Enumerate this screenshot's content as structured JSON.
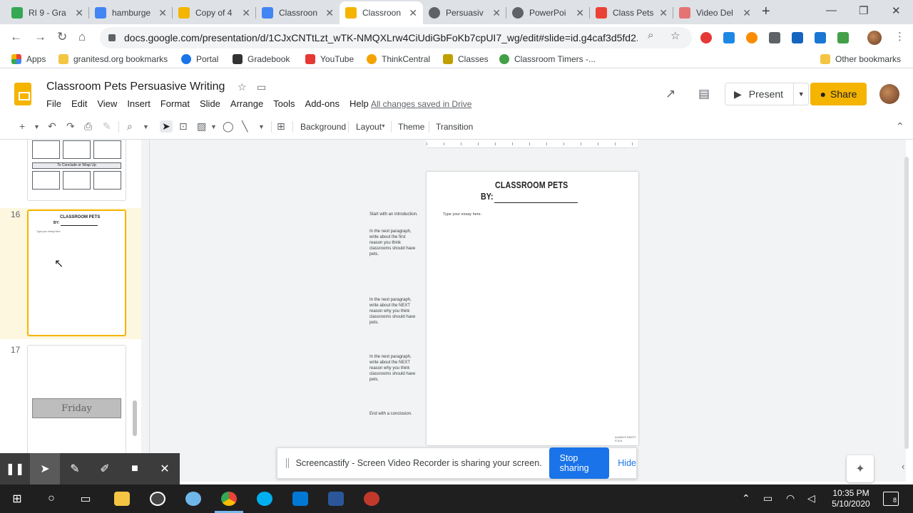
{
  "browser": {
    "tabs": [
      {
        "label": "RI 9 - Gra",
        "color": "#34a853"
      },
      {
        "label": "hamburge",
        "color": "#4285f4"
      },
      {
        "label": "Copy of 4",
        "color": "#f4b400"
      },
      {
        "label": "Classroon",
        "color": "#4285f4"
      },
      {
        "label": "Classroon",
        "color": "#f4b400"
      },
      {
        "label": "Persuasiv",
        "color": "#5f6368"
      },
      {
        "label": "PowerPoi",
        "color": "#5f6368"
      },
      {
        "label": "Class Pets",
        "color": "#ea4335"
      },
      {
        "label": "Video Del",
        "color": "#e57373"
      }
    ],
    "close_glyph": "✕",
    "new_tab_glyph": "+",
    "url": "docs.google.com/presentation/d/1CJxCNTtLzt_wTK-NMQXLrw4CiUdiGbFoKb7cpUI7_wg/edit#slide=id.g4caf3d5fd2...",
    "bookmarks": [
      {
        "label": "Apps"
      },
      {
        "label": "granitesd.org bookmarks"
      },
      {
        "label": "Portal"
      },
      {
        "label": "Gradebook"
      },
      {
        "label": "YouTube"
      },
      {
        "label": "ThinkCentral"
      },
      {
        "label": "Classes"
      },
      {
        "label": "Classroom Timers -..."
      }
    ],
    "other_bookmarks": "Other bookmarks"
  },
  "docs": {
    "title": "Classroom Pets Persuasive Writing",
    "menu": [
      "File",
      "Edit",
      "View",
      "Insert",
      "Format",
      "Slide",
      "Arrange",
      "Tools",
      "Add-ons",
      "Help"
    ],
    "saved_status": "All changes saved in Drive",
    "present_label": "Present",
    "share_label": "Share",
    "toolbar": {
      "background": "Background",
      "layout": "Layout",
      "theme": "Theme",
      "transition": "Transition"
    }
  },
  "filmstrip": {
    "thumb15": {
      "heading": "To Conclude or Wrap Up"
    },
    "thumb16": {
      "number": "16",
      "title": "CLASSROOM PETS",
      "by": "BY:",
      "body": "Type your essay here."
    },
    "thumb17": {
      "number": "17",
      "label": "Friday"
    }
  },
  "slide": {
    "title": "CLASSROOM PETS",
    "by": "BY:",
    "body": "Type your essay here.",
    "logo": "ALWAYS PARTY FOLK"
  },
  "speaker_notes": [
    "Start with an introduction.",
    "In the next paragraph, write about the first reason you think classrooms should have pets.",
    "In the next paragraph, write about the NEXT reason why you think classrooms should have pets.",
    "In the next paragraph, write about the NEXT reason why you think classrooms should have pets.",
    "End with a conclusion."
  ],
  "screencastify": {
    "message": "Screencastify - Screen Video Recorder is sharing your screen.",
    "stop_label": "Stop sharing",
    "hide_label": "Hide"
  },
  "taskbar": {
    "time": "10:35 PM",
    "date": "5/10/2020",
    "notifications": "8"
  }
}
